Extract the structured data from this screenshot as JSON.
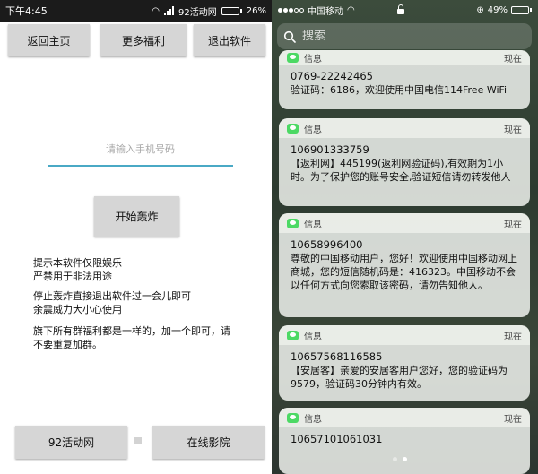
{
  "android": {
    "status": {
      "time": "下午4:45",
      "carrier": "92活动网",
      "battery": "26%",
      "battery_level": 0.26
    },
    "buttons": {
      "home": "返回主页",
      "welfare": "更多福利",
      "exit": "退出软件",
      "start": "开始轰炸",
      "site": "92活动网",
      "movie": "在线影院"
    },
    "phone_input": {
      "placeholder": "请输入手机号码",
      "value": ""
    },
    "tips": [
      [
        "提示本软件仅限娱乐",
        "严禁用于非法用途"
      ],
      [
        "停止轰炸直接退出软件过一会儿即可",
        "余震威力大小心使用"
      ],
      [
        "旗下所有群福利都是一样的，加一个即可，请",
        "不要重复加群。"
      ]
    ],
    "colors": {
      "button_bg": "#d6d6d6",
      "input_underline": "#4aa9c5",
      "status_bar": "#1b1b1b"
    }
  },
  "ios": {
    "status": {
      "carrier": "中国移动",
      "battery": "49%",
      "battery_level": 0.49
    },
    "search": {
      "placeholder": "搜索"
    },
    "notifications": [
      {
        "app": "信息",
        "time": "现在",
        "sender": "0769-22242465",
        "body": "验证码：6186，欢迎使用中国电信114Free WiFi"
      },
      {
        "app": "信息",
        "time": "现在",
        "sender": "106901333759",
        "body": "【返利网】445199(返利网验证码),有效期为1小时。为了保护您的账号安全,验证短信请勿转发他人"
      },
      {
        "app": "信息",
        "time": "现在",
        "sender": "10658996400",
        "body": "尊敬的中国移动用户，您好！欢迎使用中国移动网上商城，您的短信随机码是：416323。中国移动不会以任何方式向您索取该密码，请勿告知他人。"
      },
      {
        "app": "信息",
        "time": "现在",
        "sender": "10657568116585",
        "body": "【安居客】亲爱的安居客用户您好，您的验证码为9579，验证码30分钟内有效。"
      },
      {
        "app": "信息",
        "time": "现在",
        "sender": "10657101061031",
        "body": ""
      }
    ],
    "pager": {
      "pages": 2,
      "current": 2
    },
    "colors": {
      "message_icon": "#4cd964"
    }
  }
}
